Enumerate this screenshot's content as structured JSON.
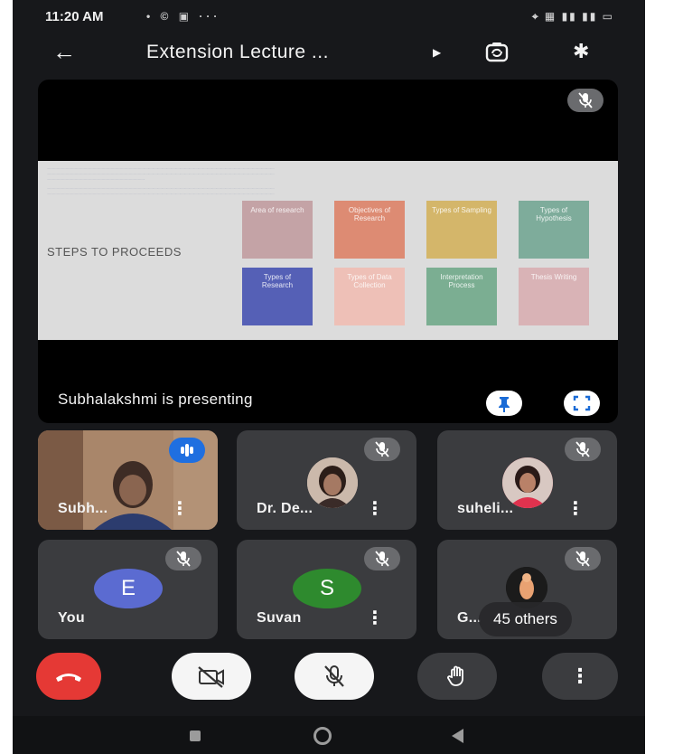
{
  "status_bar": {
    "time": "11:20 AM",
    "notification_icons": "• © ▣ ···",
    "system_icons": "⌖ ▦ ▮▮ ▮▮ ▭"
  },
  "meeting": {
    "title": "Extension Lecture ..."
  },
  "presentation": {
    "caption": "Subhalakshmi is presenting",
    "slide_heading": "STEPS TO PROCEEDS",
    "slide_boxes": [
      {
        "label": "Area of research",
        "color": "#c4a3a6"
      },
      {
        "label": "Objectives of Research",
        "color": "#dd8b73"
      },
      {
        "label": "Types of Sampling",
        "color": "#d4b66a"
      },
      {
        "label": "Types of Hypothesis",
        "color": "#7eac9b"
      },
      {
        "label": "Types of Research",
        "color": "#5560b6"
      },
      {
        "label": "Types of Data Collection",
        "color": "#eec0b7"
      },
      {
        "label": "Interpretation Process",
        "color": "#7bae92"
      },
      {
        "label": "Thesis Writing",
        "color": "#d9b3b6"
      }
    ]
  },
  "participants": [
    {
      "name": "Subh...",
      "speaking": true
    },
    {
      "name": "Dr. De..."
    },
    {
      "name": "suheli..."
    },
    {
      "name": "You",
      "initial": "E",
      "avatar_color": "#5b6bd1"
    },
    {
      "name": "Suvan",
      "initial": "S",
      "avatar_color": "#2e8a2e"
    },
    {
      "name": "G...",
      "others_label": "45 others"
    }
  ],
  "controls": {
    "hangup_color": "#e53935"
  }
}
